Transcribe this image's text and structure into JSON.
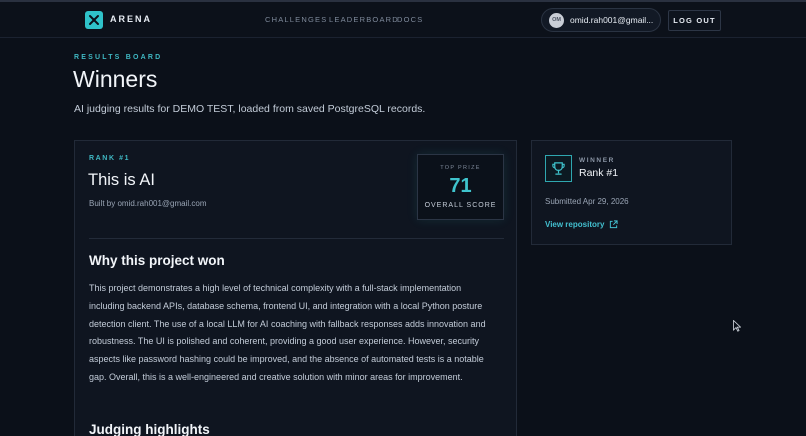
{
  "nav": {
    "brand": "ARENA",
    "links": [
      "CHALLENGES",
      "LEADERBOARD",
      "DOCS"
    ],
    "user_initials": "OM",
    "user_email": "omid.rah001@gmail...",
    "logout_label": "LOG OUT"
  },
  "header": {
    "eyebrow": "RESULTS BOARD",
    "title": "Winners",
    "subtitle": "AI judging results for DEMO TEST, loaded from saved PostgreSQL records."
  },
  "winner_card": {
    "rank_label": "RANK #1",
    "project_title": "This is AI",
    "built_by": "Built by omid.rah001@gmail.com",
    "prize_label": "TOP PRIZE",
    "score": "71",
    "score_caption": "OVERALL SCORE",
    "why_heading": "Why this project won",
    "why_text": "This project demonstrates a high level of technical complexity with a full-stack implementation including backend APIs, database schema, frontend UI, and integration with a local Python posture detection client. The use of a local LLM for AI coaching with fallback responses adds innovation and robustness. The UI is polished and coherent, providing a good user experience. However, security aspects like password hashing could be improved, and the absence of automated tests is a notable gap. Overall, this is a well-engineered and creative solution with minor areas for improvement.",
    "highlights_heading": "Judging highlights"
  },
  "side_card": {
    "winner_label": "WINNER",
    "rank": "Rank #1",
    "submitted": "Submitted Apr 29, 2026",
    "repo_link": "View repository"
  },
  "colors": {
    "accent": "#3fc4cd",
    "background": "#0b1019",
    "card": "#0f1520"
  }
}
